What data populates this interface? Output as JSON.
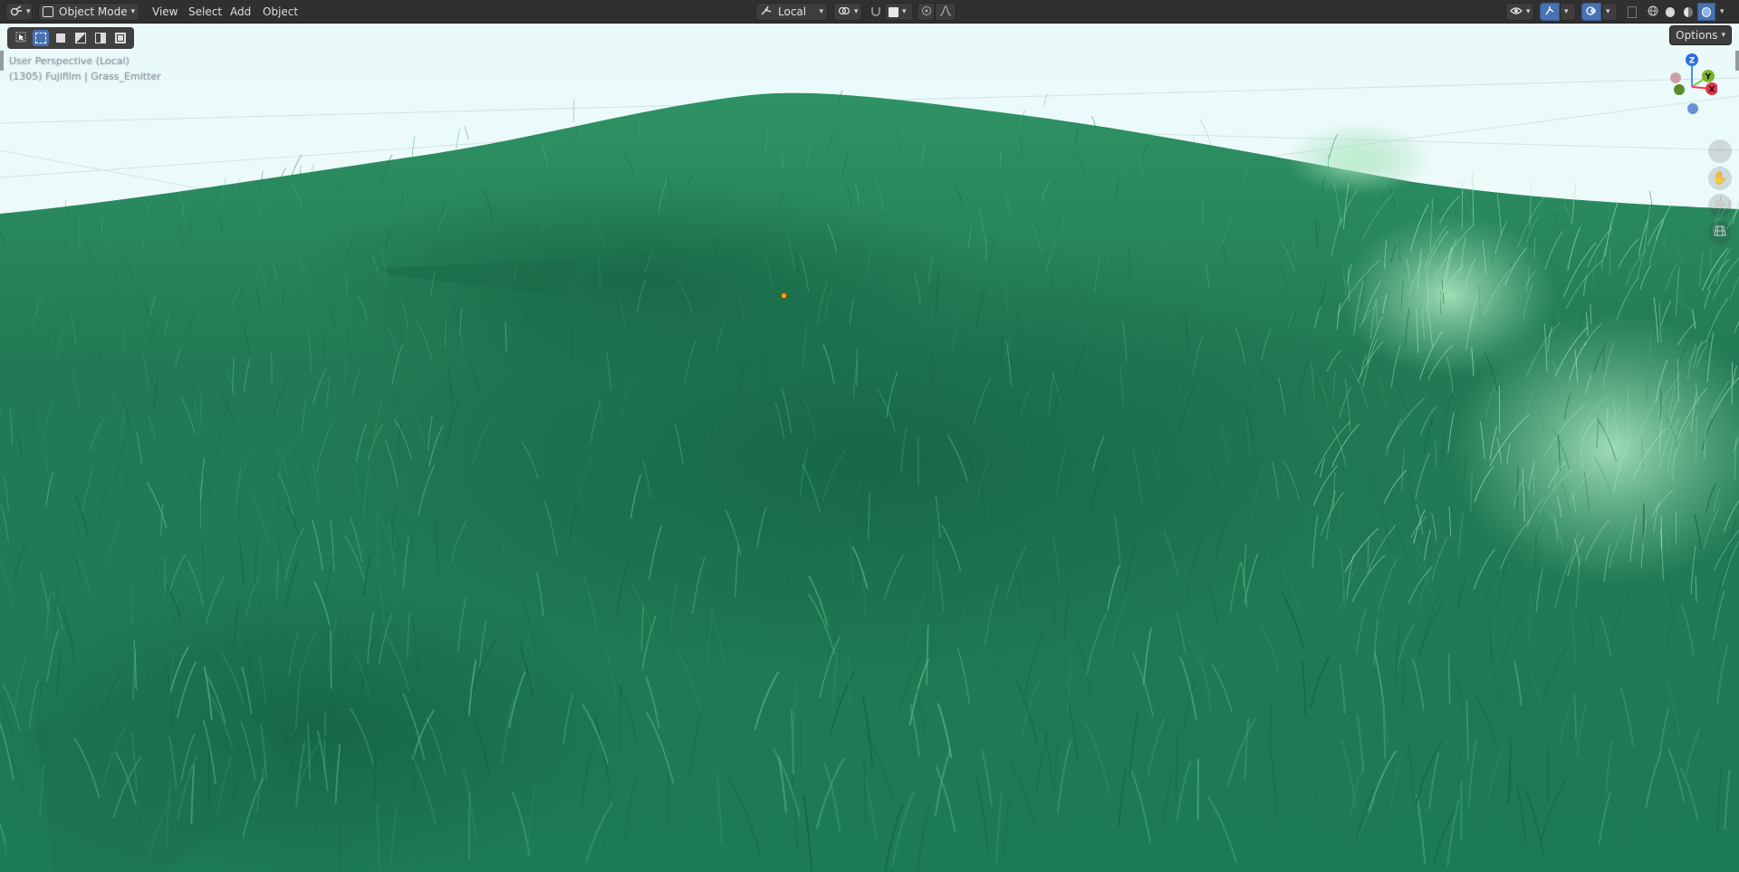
{
  "header": {
    "editor_type_icon": "3d-viewport-icon",
    "mode": {
      "label": "Object Mode",
      "icon": "object-mode-icon"
    },
    "menus": [
      "View",
      "Select",
      "Add",
      "Object"
    ],
    "transform_orientation": {
      "label": "Local",
      "icon": "orientation-icon"
    },
    "pivot_icon": "pivot-icon",
    "snap_icon": "snap-icon",
    "proportional_icon": "proportional-edit-icon",
    "falloff_icon": "falloff-curve-icon",
    "right_icons": [
      "visibility-eye-icon",
      "gizmo-icon",
      "overlay-icon",
      "xray-icon",
      "wireframe-shading-icon",
      "solid-shading-icon",
      "material-shading-icon",
      "rendered-shading-icon"
    ]
  },
  "viewport": {
    "info_line_1": "User Perspective (Local)",
    "info_line_2": "(1305) Fujifilm | Grass_Emitter",
    "options_label": "Options",
    "gizmo": {
      "z": "Z",
      "y": "Y",
      "x": "X"
    },
    "nav_icons": [
      "zoom-icon",
      "pan-hand-icon",
      "camera-icon",
      "grid-toggle-icon"
    ],
    "colors": {
      "sky": "#eefafa",
      "grass_light": "#3a9a6a",
      "grass_dark": "#176b4a",
      "grass_highlight": "#8fd6a8",
      "accent": "#4772b3"
    }
  }
}
